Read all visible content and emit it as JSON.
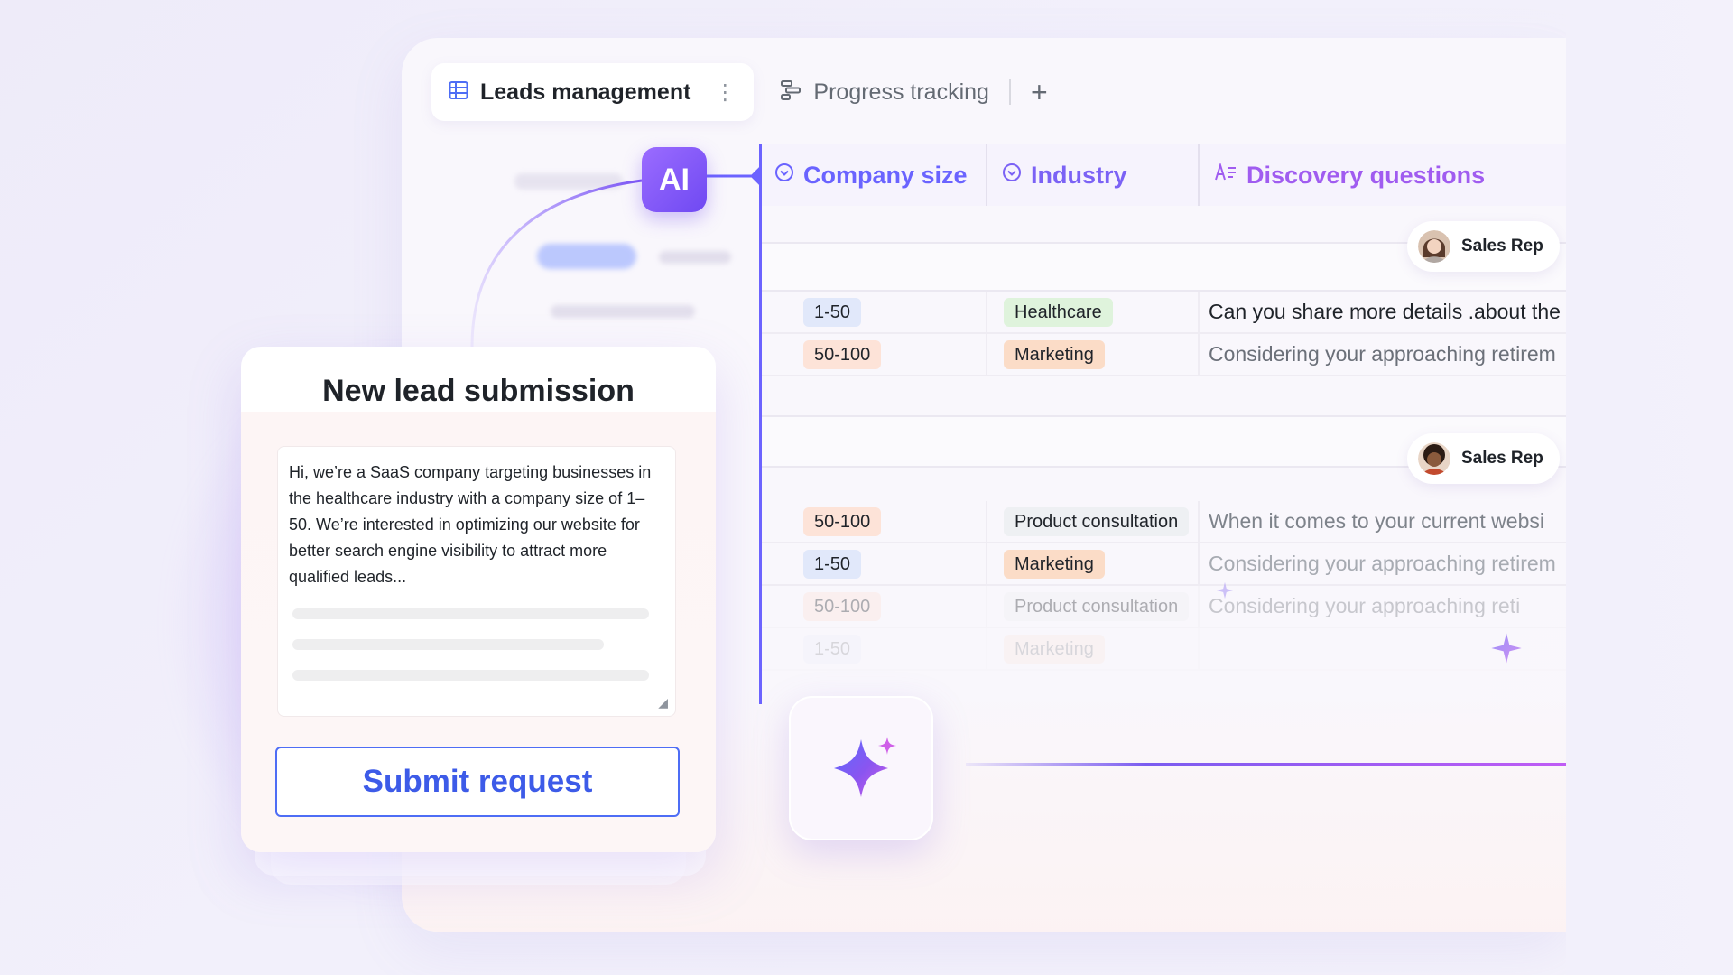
{
  "tabs": [
    {
      "label": "Leads management",
      "icon": "table-icon",
      "active": true,
      "more": "⋮"
    },
    {
      "label": "Progress tracking",
      "icon": "progress-icon",
      "active": false
    }
  ],
  "add_tab_label": "+",
  "ai_badge": "AI",
  "columns": [
    {
      "label": "Company size",
      "icon": "single-select-icon"
    },
    {
      "label": "Industry",
      "icon": "single-select-icon"
    },
    {
      "label": "Discovery questions",
      "icon": "ai-text-icon"
    }
  ],
  "groups": [
    {
      "assignee": "Sales Rep",
      "rows": [
        {
          "size": "1-50",
          "size_color": "blue",
          "industry": "Healthcare",
          "industry_color": "green",
          "question": "Can you share more details .about the"
        },
        {
          "size": "50-100",
          "size_color": "peach",
          "industry": "Marketing",
          "industry_color": "orange",
          "question": "Considering your approaching retirem"
        }
      ]
    },
    {
      "assignee": "Sales Rep",
      "rows": [
        {
          "size": "50-100",
          "size_color": "peach",
          "industry": "Product consultation",
          "industry_color": "grey",
          "question": "When it comes to your current websi"
        },
        {
          "size": "1-50",
          "size_color": "blue",
          "industry": "Marketing",
          "industry_color": "orange",
          "question": "Considering your approaching retirem"
        },
        {
          "size": "50-100",
          "size_color": "peach",
          "industry": "Product consultation",
          "industry_color": "grey",
          "question": "Considering your approaching reti"
        },
        {
          "size": "1-50",
          "size_color": "blue",
          "industry": "Marketing",
          "industry_color": "orange",
          "question": ""
        }
      ]
    }
  ],
  "form": {
    "title": "New lead submission",
    "message": "Hi, we’re a SaaS company targeting businesses in the healthcare industry with a company size of 1–50. We’re interested in optimizing our website for better search engine visibility to attract more qualified leads...",
    "submit_label": "Submit request"
  },
  "colors": {
    "accent": "#6c63ff",
    "ai_purple": "#7b55f5",
    "submit_blue": "#3d5be8"
  }
}
